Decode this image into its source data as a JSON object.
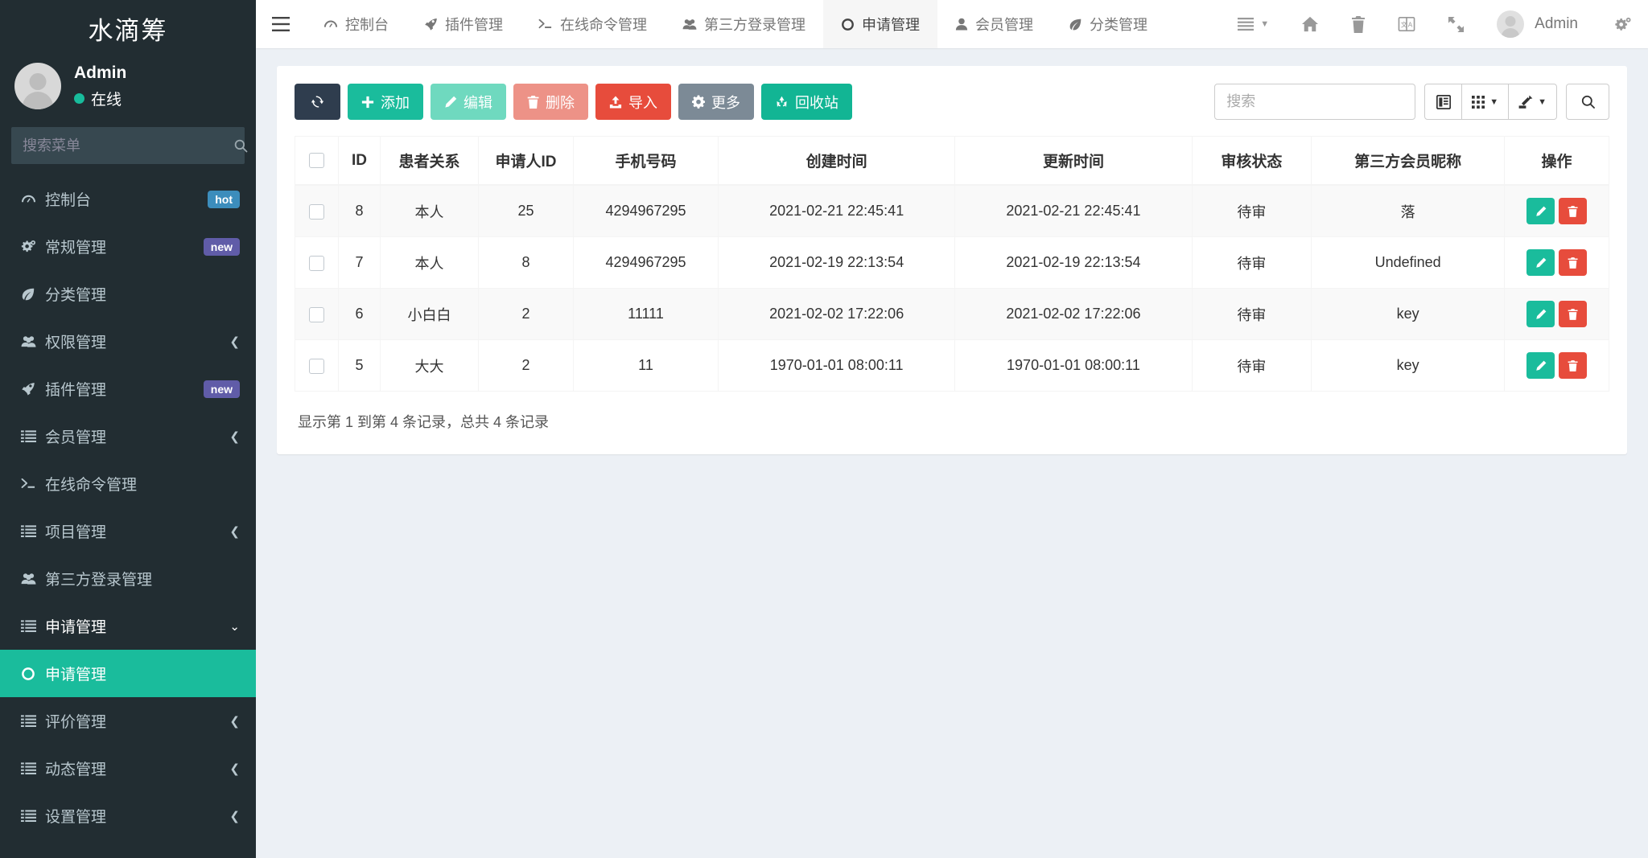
{
  "sidebar": {
    "brand": "水滴筹",
    "user": {
      "name": "Admin",
      "status": "在线"
    },
    "search_placeholder": "搜索菜单",
    "items": [
      {
        "label": "控制台",
        "icon": "dashboard-icon",
        "badge": "hot",
        "badge_type": "hot",
        "caret": "",
        "active": false
      },
      {
        "label": "常规管理",
        "icon": "gears-icon",
        "badge": "new",
        "badge_type": "new",
        "caret": "",
        "active": false
      },
      {
        "label": "分类管理",
        "icon": "leaf-icon",
        "badge": "",
        "badge_type": "",
        "caret": "",
        "active": false
      },
      {
        "label": "权限管理",
        "icon": "users-icon",
        "badge": "",
        "badge_type": "",
        "caret": "right",
        "active": false
      },
      {
        "label": "插件管理",
        "icon": "rocket-icon",
        "badge": "new",
        "badge_type": "new",
        "caret": "",
        "active": false
      },
      {
        "label": "会员管理",
        "icon": "list-icon",
        "badge": "",
        "badge_type": "",
        "caret": "right",
        "active": false
      },
      {
        "label": "在线命令管理",
        "icon": "terminal-icon",
        "badge": "",
        "badge_type": "",
        "caret": "",
        "active": false
      },
      {
        "label": "项目管理",
        "icon": "list-icon",
        "badge": "",
        "badge_type": "",
        "caret": "right",
        "active": false
      },
      {
        "label": "第三方登录管理",
        "icon": "users-icon",
        "badge": "",
        "badge_type": "",
        "caret": "",
        "active": false
      },
      {
        "label": "申请管理",
        "icon": "list-icon",
        "badge": "",
        "badge_type": "",
        "caret": "down",
        "active": false,
        "open": true
      },
      {
        "label": "申请管理",
        "icon": "circle-o-icon",
        "badge": "",
        "badge_type": "",
        "caret": "",
        "active": true,
        "sub": true
      },
      {
        "label": "评价管理",
        "icon": "list-icon",
        "badge": "",
        "badge_type": "",
        "caret": "right",
        "active": false
      },
      {
        "label": "动态管理",
        "icon": "list-icon",
        "badge": "",
        "badge_type": "",
        "caret": "right",
        "active": false
      },
      {
        "label": "设置管理",
        "icon": "list-icon",
        "badge": "",
        "badge_type": "",
        "caret": "right",
        "active": false
      }
    ]
  },
  "topnav": {
    "items": [
      {
        "label": "控制台",
        "icon": "dashboard-icon",
        "active": false
      },
      {
        "label": "插件管理",
        "icon": "rocket-icon",
        "active": false
      },
      {
        "label": "在线命令管理",
        "icon": "terminal-icon",
        "active": false
      },
      {
        "label": "第三方登录管理",
        "icon": "users-icon",
        "active": false
      },
      {
        "label": "申请管理",
        "icon": "circle-o-icon",
        "active": true
      },
      {
        "label": "会员管理",
        "icon": "user-icon",
        "active": false
      },
      {
        "label": "分类管理",
        "icon": "leaf-icon",
        "active": false
      }
    ],
    "right": {
      "menu_icon": "bars-icon",
      "home_icon": "home-icon",
      "trash_icon": "trash-icon",
      "language_icon": "language-icon",
      "fullscreen_icon": "expand-icon",
      "user_name": "Admin",
      "settings_icon": "gears-icon"
    }
  },
  "toolbar": {
    "refresh_icon": "refresh-icon",
    "buttons": [
      {
        "label": "添加",
        "icon": "plus-icon",
        "style": "btn-green"
      },
      {
        "label": "编辑",
        "icon": "pencil-icon",
        "style": "btn-green-l"
      },
      {
        "label": "删除",
        "icon": "trash-icon",
        "style": "btn-red-l"
      },
      {
        "label": "导入",
        "icon": "upload-icon",
        "style": "btn-red"
      },
      {
        "label": "更多",
        "icon": "gear-icon",
        "style": "btn-gray"
      },
      {
        "label": "回收站",
        "icon": "recycle-icon",
        "style": "btn-teal"
      }
    ],
    "search_placeholder": "搜索",
    "search_value": "",
    "controls": [
      {
        "icon": "columns-icon",
        "caret": false
      },
      {
        "icon": "grid-icon",
        "caret": true
      },
      {
        "icon": "export-icon",
        "caret": true
      }
    ],
    "search_button_icon": "search-icon"
  },
  "table": {
    "columns": [
      "",
      "ID",
      "患者关系",
      "申请人ID",
      "手机号码",
      "创建时间",
      "更新时间",
      "审核状态",
      "第三方会员昵称",
      "操作"
    ],
    "rows": [
      {
        "id": "8",
        "relation": "本人",
        "applicant_id": "25",
        "phone": "4294967295",
        "created": "2021-02-21 22:45:41",
        "updated": "2021-02-21 22:45:41",
        "status": "待审",
        "nickname": "落"
      },
      {
        "id": "7",
        "relation": "本人",
        "applicant_id": "8",
        "phone": "4294967295",
        "created": "2021-02-19 22:13:54",
        "updated": "2021-02-19 22:13:54",
        "status": "待审",
        "nickname": "Undefined"
      },
      {
        "id": "6",
        "relation": "小白白",
        "applicant_id": "2",
        "phone": "11111",
        "created": "2021-02-02 17:22:06",
        "updated": "2021-02-02 17:22:06",
        "status": "待审",
        "nickname": "key"
      },
      {
        "id": "5",
        "relation": "大大",
        "applicant_id": "2",
        "phone": "11",
        "created": "1970-01-01 08:00:11",
        "updated": "1970-01-01 08:00:11",
        "status": "待审",
        "nickname": "key"
      }
    ],
    "row_actions": {
      "edit_icon": "pencil-icon",
      "delete_icon": "trash-icon"
    },
    "footer": "显示第 1 到第 4 条记录，总共 4 条记录"
  },
  "colors": {
    "sidebar_bg": "#222d32",
    "accent_green": "#1abc9c",
    "danger_red": "#e74c3c",
    "dark_btn": "#2f3d4e",
    "content_bg": "#ecf0f5"
  }
}
